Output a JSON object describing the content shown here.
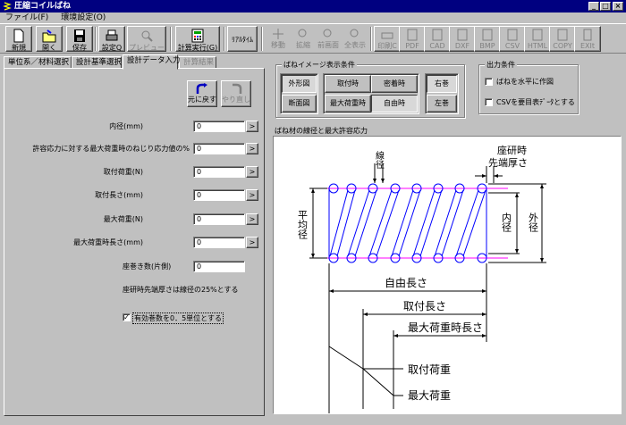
{
  "window": {
    "title": "圧縮コイルばね"
  },
  "menu": [
    "ファイル(F)",
    "環境設定(O)"
  ],
  "toolbar": {
    "buttons": [
      {
        "label": "新規",
        "icon": "new-file-icon"
      },
      {
        "label": "開く",
        "icon": "open-folder-icon"
      },
      {
        "label": "保存",
        "icon": "save-disk-icon"
      },
      {
        "label": "設定Q",
        "icon": "print-setup-icon"
      },
      {
        "label": "プレビュー",
        "icon": "preview-icon"
      },
      {
        "label": "計算実行(G)",
        "icon": "calculator-icon"
      }
    ],
    "realtime_label": "ﾘｱﾙﾀｲﾑ",
    "view_buttons": [
      {
        "label": "移動",
        "icon": "move-icon"
      },
      {
        "label": "拡縮",
        "icon": "zoom-icon"
      },
      {
        "label": "前画面",
        "icon": "previous-view-icon"
      },
      {
        "label": "全表示",
        "icon": "fit-all-icon"
      }
    ],
    "export_buttons": [
      {
        "label": "印刷C",
        "icon": "print-icon"
      },
      {
        "label": "PDF",
        "icon": "pdf-icon"
      },
      {
        "label": "CAD",
        "icon": "cad-icon"
      },
      {
        "label": "DXF",
        "icon": "dxf-icon"
      },
      {
        "label": "BMP",
        "icon": "bmp-icon"
      },
      {
        "label": "CSV",
        "icon": "csv-icon"
      },
      {
        "label": "HTML",
        "icon": "html-icon"
      },
      {
        "label": "COPY",
        "icon": "copy-icon"
      },
      {
        "label": "EXIt",
        "icon": "exit-icon"
      }
    ]
  },
  "tabs": [
    "単位系／材料選択",
    "設計基準選択",
    "設計データ入力",
    "計算結果"
  ],
  "form": {
    "undo_label": "元に戻す",
    "redo_label": "やり直し",
    "fields": [
      {
        "label": "内径(mm)",
        "value": "0"
      },
      {
        "label": "許容応力に対する最大荷重時のねじり応力値の%",
        "value": "0"
      },
      {
        "label": "取付荷重(N)",
        "value": "0"
      },
      {
        "label": "取付長さ(mm)",
        "value": "0"
      },
      {
        "label": "最大荷重(N)",
        "value": "0"
      },
      {
        "label": "最大荷重時長さ(mm)",
        "value": "0"
      }
    ],
    "seat_turns_label": "座巻き数(片側)",
    "seat_turns_value": "0",
    "note": "座研時先端厚さは線径の25%とする",
    "effective_turns_label": "有効巻数を0．5単位とする",
    "effective_turns_checked": true
  },
  "image_conditions": {
    "title": "ばねイメージ表示条件",
    "view_buttons": [
      "外形図",
      "断面図"
    ],
    "state_buttons": [
      "取付時",
      "密着時",
      "最大荷重時",
      "自由時"
    ],
    "wind_buttons": [
      "右巻",
      "左巻"
    ]
  },
  "output_conditions": {
    "title": "出力条件",
    "options": [
      {
        "label": "ばねを水平に作図",
        "checked": false
      },
      {
        "label": "CSVを要目表ﾃﾞｰﾀとする",
        "checked": false
      }
    ]
  },
  "drawing": {
    "section_label": "ばね材の線径と最大許容応力",
    "labels": {
      "wire_dia": "線径",
      "seat_thickness": "座研時\n先端厚さ",
      "mean_dia": "平均径",
      "inner_dia": "内径",
      "outer_dia": "外径",
      "free_length": "自由長さ",
      "installed_length": "取付長さ",
      "max_load_length": "最大荷重時長さ",
      "installed_load": "取付荷重",
      "max_load": "最大荷重"
    },
    "colors": {
      "coil": "#0000ff",
      "centerline": "#ff00ff",
      "dims": "#000000"
    }
  }
}
